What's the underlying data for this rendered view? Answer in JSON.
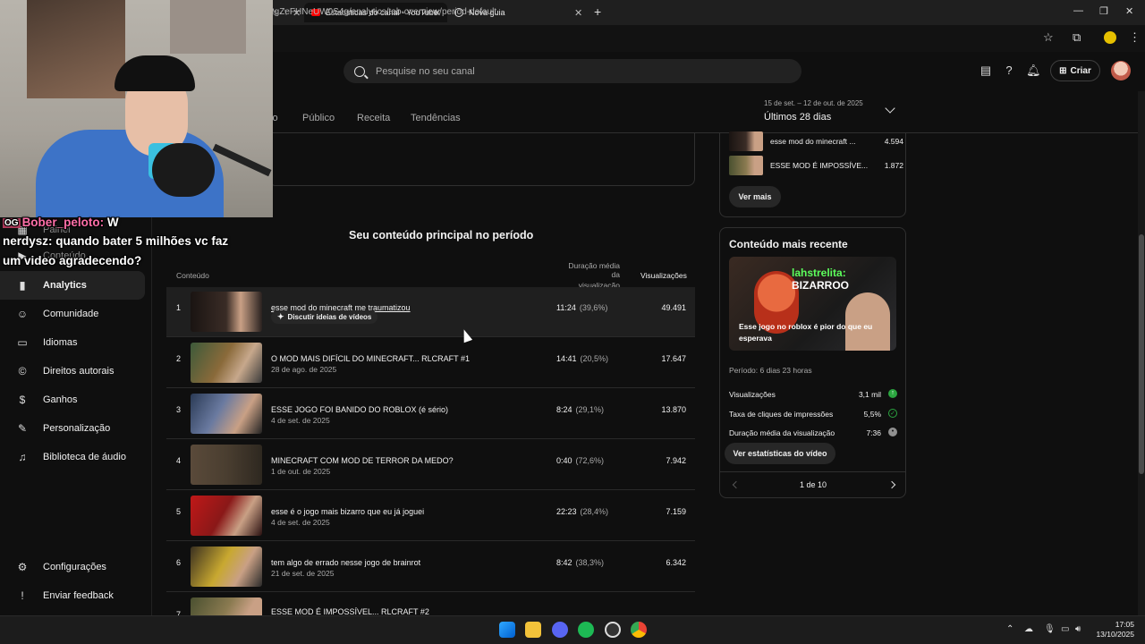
{
  "browser": {
    "tabs": [
      {
        "label": "Estatísticas do canal - YouTube"
      },
      {
        "label": "Nova guia"
      }
    ],
    "url": "PgZeFHNeUW0S4g/analytics/tab-overview/period-default"
  },
  "header": {
    "search_placeholder": "Pesquise no seu canal",
    "create_label": "Criar"
  },
  "analytics_tabs": [
    {
      "label": "lo"
    },
    {
      "label": "Público"
    },
    {
      "label": "Receita"
    },
    {
      "label": "Tendências"
    }
  ],
  "date_range": {
    "sub": "15 de set. – 12 de out. de 2025",
    "main": "Últimos 28 dias"
  },
  "sidebar": {
    "partial_items": [
      {
        "label": "Painel"
      },
      {
        "label": "Conteúdo"
      }
    ],
    "items": [
      {
        "label": "Analytics"
      },
      {
        "label": "Comunidade"
      },
      {
        "label": "Idiomas"
      },
      {
        "label": "Direitos autorais"
      },
      {
        "label": "Ganhos"
      },
      {
        "label": "Personalização"
      },
      {
        "label": "Biblioteca de áudio"
      }
    ],
    "bottom_items": [
      {
        "label": "Configurações"
      },
      {
        "label": "Enviar feedback"
      }
    ]
  },
  "top_content": {
    "title": "Seu conteúdo principal no período",
    "col_content": "Conteúdo",
    "col_duration_1": "Duração média da",
    "col_duration_2": "visualização",
    "col_views": "Visualizações",
    "discuss_label": "Discutir ideias de vídeos",
    "rows": [
      {
        "rank": "1",
        "title": "esse mod do minecraft me traumatizou",
        "date": "",
        "duration": "11:24",
        "pct": "(39,6%)",
        "views": "49.491",
        "thumb": "#2a2220"
      },
      {
        "rank": "2",
        "title": "O MOD MAIS DIFÍCIL DO MINECRAFT... RLCRAFT #1",
        "date": "28 de ago. de 2025",
        "duration": "14:41",
        "pct": "(20,5%)",
        "views": "17.647",
        "thumb": "#3c5a3a"
      },
      {
        "rank": "3",
        "title": "ESSE JOGO FOI BANIDO DO ROBLOX (é sério)",
        "date": "4 de set. de 2025",
        "duration": "8:24",
        "pct": "(29,1%)",
        "views": "13.870",
        "thumb": "#2a3a55"
      },
      {
        "rank": "4",
        "title": "MINECRAFT COM MOD DE TERROR DA MEDO?",
        "date": "1 de out. de 2025",
        "duration": "0:40",
        "pct": "(72,6%)",
        "views": "7.942",
        "thumb": "#4a3e30"
      },
      {
        "rank": "5",
        "title": "esse é o jogo mais bizarro que eu já joguei",
        "date": "4 de set. de 2025",
        "duration": "22:23",
        "pct": "(28,4%)",
        "views": "7.159",
        "thumb": "#8a1818"
      },
      {
        "rank": "6",
        "title": "tem algo de errado nesse jogo de brainrot",
        "date": "21 de set. de 2025",
        "duration": "8:42",
        "pct": "(38,3%)",
        "views": "6.342",
        "thumb": "#5a4a20"
      },
      {
        "rank": "7",
        "title": "ESSE MOD É IMPOSSÍVEL... RLCRAFT #2",
        "date": "",
        "duration": "",
        "pct": "",
        "views": "",
        "thumb": "#4a5030"
      }
    ]
  },
  "right_panel": {
    "list": [
      {
        "title": "esse mod do minecraft ...",
        "value": "4.594",
        "thumb": "#2a2220"
      },
      {
        "title": "ESSE MOD É IMPOSSÍVE...",
        "value": "1.872",
        "thumb": "#4a5030"
      }
    ],
    "see_more": "Ver mais",
    "latest_title": "Conteúdo mais recente",
    "thumb_caption_user": "lahstrelita:",
    "thumb_caption_msg": "BIZARROO",
    "thumb_caption_bottom": "Esse jogo no roblox é pior do que eu esperava",
    "period": "Período: 6 dias 23 horas",
    "stats": [
      {
        "label": "Visualizações",
        "value": "3,1 mil",
        "color": "#2ba640"
      },
      {
        "label": "Taxa de cliques de impressões",
        "value": "5,5%",
        "color": "#2ba640"
      },
      {
        "label": "Duração média da visualização",
        "value": "7:36",
        "color": "#909090"
      }
    ],
    "stats_button": "Ver estatísticas do vídeo",
    "pager": "1 de 10"
  },
  "overlay_chat": [
    {
      "badge": "OG",
      "user": "Bober_peloto:",
      "msg": "W"
    },
    {
      "badge": "",
      "user": "nerdysz:",
      "msg": "quando bater 5 milhões vc faz"
    },
    {
      "badge": "",
      "user": "",
      "msg": "um video agradecendo?"
    }
  ],
  "taskbar": {
    "time": "17:05",
    "date": "13/10/2025"
  }
}
